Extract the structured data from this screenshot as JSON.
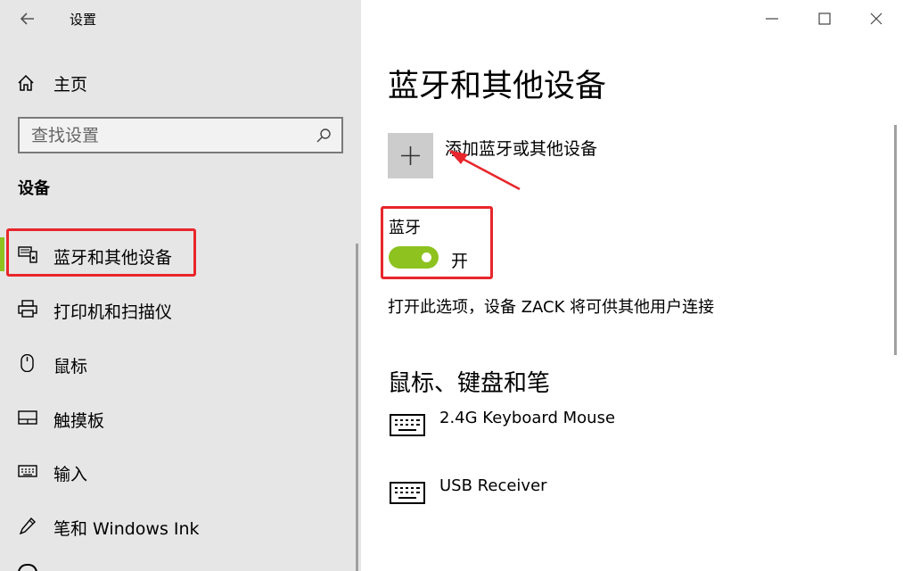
{
  "window": {
    "title": "设置",
    "back_icon": "back-arrow-icon",
    "controls": [
      "minimize-icon",
      "maximize-icon",
      "close-icon"
    ]
  },
  "sidebar": {
    "home_label": "主页",
    "search_placeholder": "查找设置",
    "section_title": "设备",
    "items": [
      {
        "label": "蓝牙和其他设备",
        "icon": "bluetooth-devices-icon",
        "active": true
      },
      {
        "label": "打印机和扫描仪",
        "icon": "printer-icon",
        "active": false
      },
      {
        "label": "鼠标",
        "icon": "mouse-icon",
        "active": false
      },
      {
        "label": "触摸板",
        "icon": "touchpad-icon",
        "active": false
      },
      {
        "label": "输入",
        "icon": "keyboard-icon",
        "active": false
      },
      {
        "label": "笔和 Windows Ink",
        "icon": "pen-icon",
        "active": false
      }
    ]
  },
  "main": {
    "title": "蓝牙和其他设备",
    "add_device_label": "添加蓝牙或其他设备",
    "bluetooth": {
      "label": "蓝牙",
      "state_label": "开",
      "enabled": true,
      "description": "打开此选项，设备 ZACK 将可供其他用户连接"
    },
    "devices_section_title": "鼠标、键盘和笔",
    "devices": [
      {
        "name": "2.4G Keyboard Mouse",
        "icon": "keyboard-icon"
      },
      {
        "name": "USB Receiver",
        "icon": "keyboard-icon"
      }
    ]
  },
  "colors": {
    "accent": "#8dc21f",
    "annotation_red": "#e8262b",
    "sidebar_bg": "#e6e6e6"
  }
}
